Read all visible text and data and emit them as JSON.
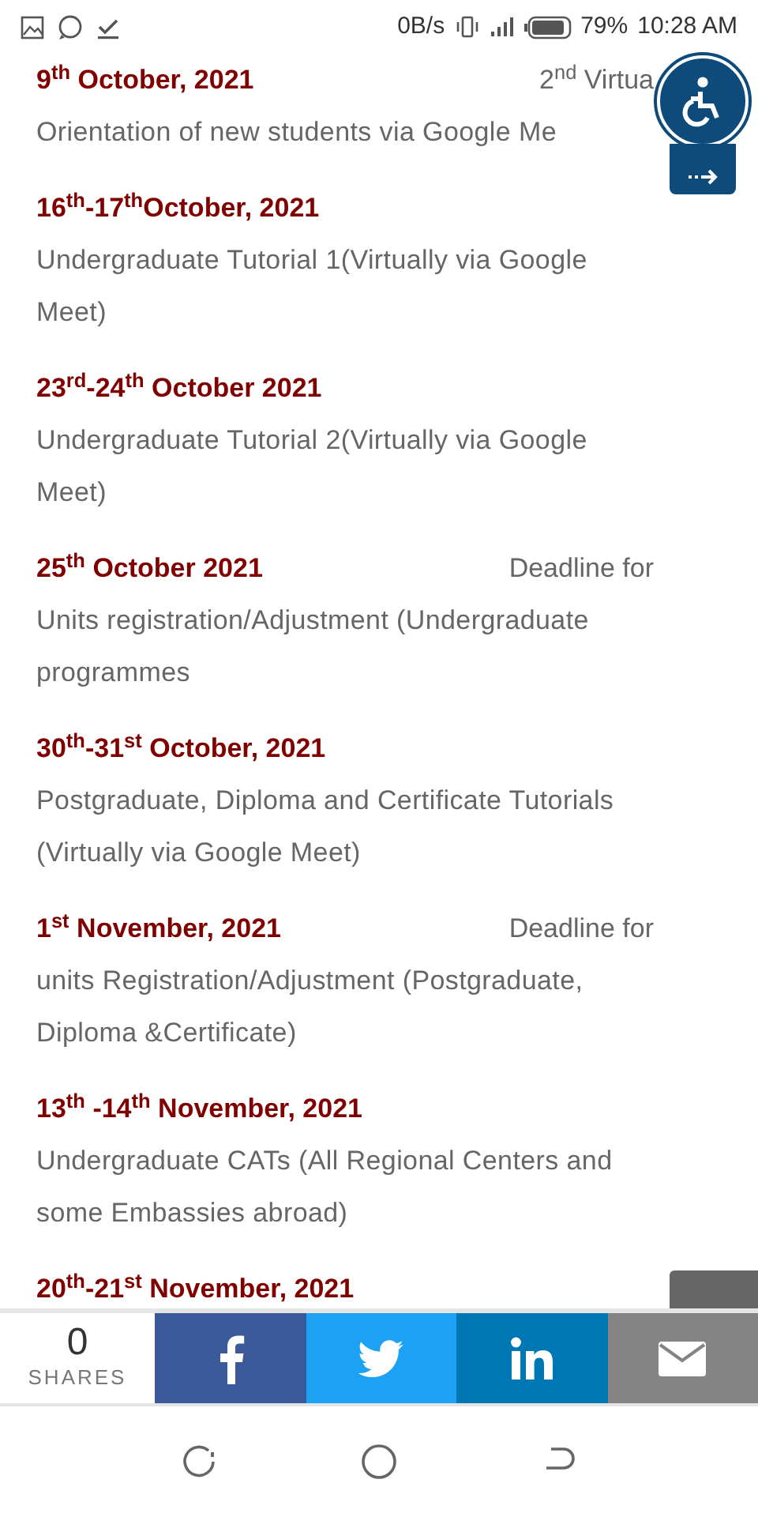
{
  "status_bar": {
    "speed": "0B/s",
    "battery": "79%",
    "time": "10:28 AM"
  },
  "entries": [
    {
      "date": "9$^{th}$ October, 2021",
      "aside": "2$^{nd}$ Virtua",
      "description": "Orientation of new students via Google Me"
    },
    {
      "date": "16$^{th}$-17$^{th}$October, 2021",
      "description": "Undergraduate Tutorial 1(Virtually via Google Meet)"
    },
    {
      "date": "23$^{rd}$-24$^{th}$ October 2021",
      "description": "Undergraduate Tutorial 2(Virtually via Google Meet)"
    },
    {
      "date": "25$^{th}$ October 2021",
      "aside": "Deadline for",
      "description": "Units registration/Adjustment (Undergraduate programmes"
    },
    {
      "date": "30$^{th}$-31$^{st}$ October, 2021",
      "description": "Postgraduate, Diploma and Certificate Tutorials (Virtually via Google Meet)"
    },
    {
      "date": "1$^{st}$ November, 2021",
      "aside": "Deadline for",
      "description": "units Registration/Adjustment (Postgraduate, Diploma &Certificate)"
    },
    {
      "date": "13$^{th}$ -14$^{th}$ November, 2021",
      "description": "Undergraduate CATs (All Regional Centers and some Embassies abroad)"
    },
    {
      "date": "20$^{th}$-21$^{st}$ November, 2021"
    }
  ],
  "share_bar": {
    "count": "0",
    "label": "SHARES",
    "buttons": [
      {
        "kind": "facebook"
      },
      {
        "kind": "twitter"
      },
      {
        "kind": "linkedin"
      },
      {
        "kind": "email"
      }
    ]
  }
}
